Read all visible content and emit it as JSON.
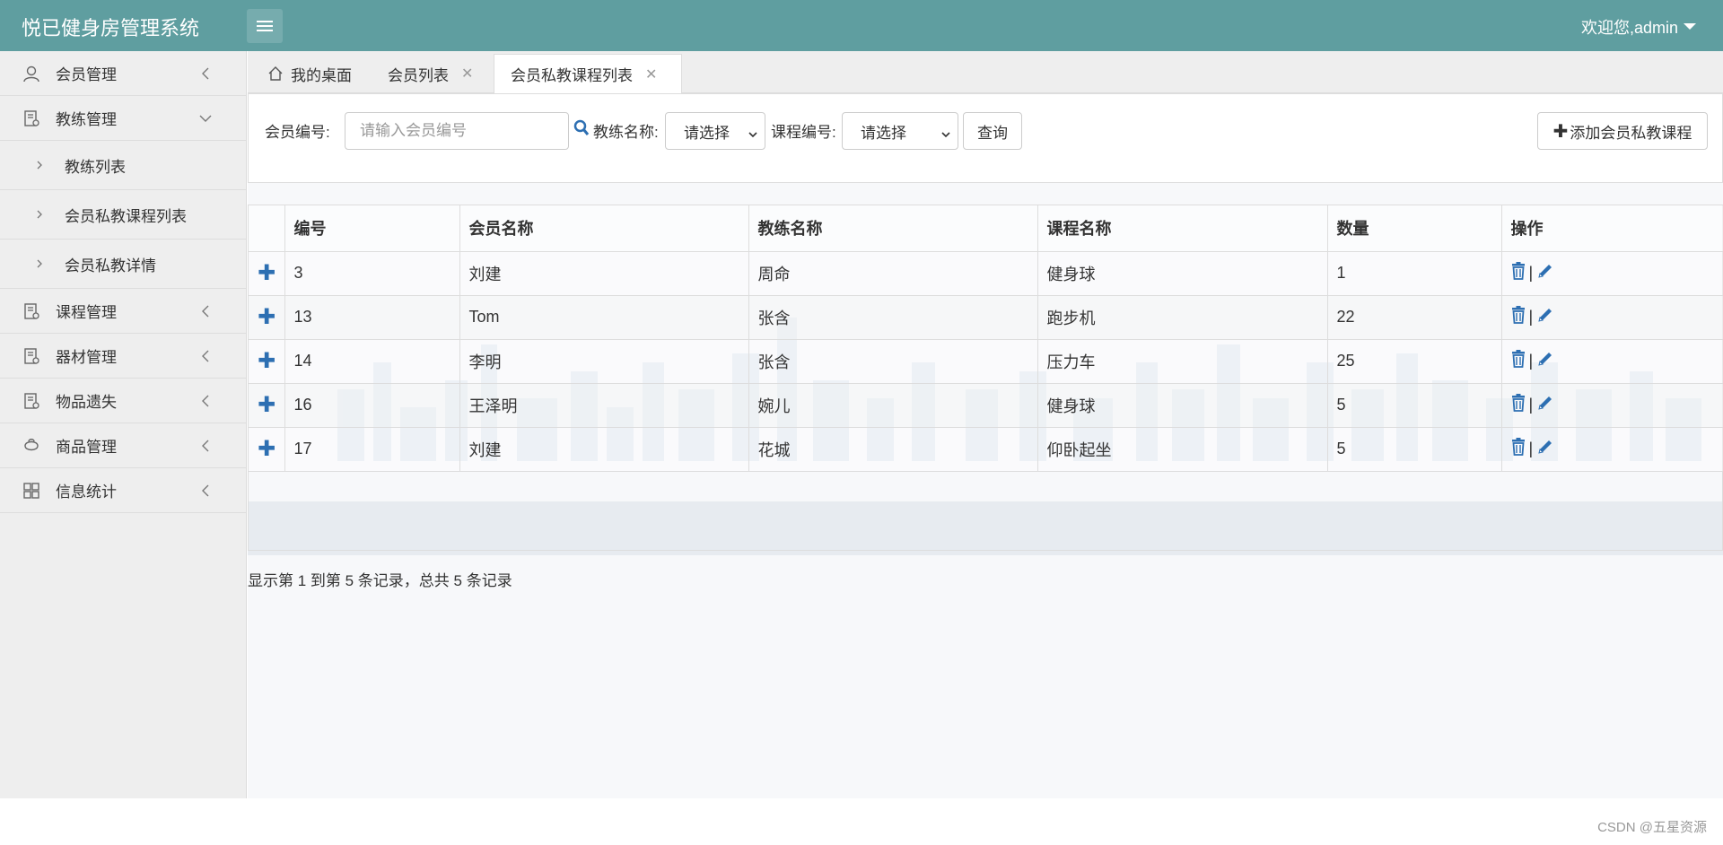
{
  "header": {
    "brand": "悦已健身房管理系统",
    "welcome": "欢迎您,admin",
    "bg_color": "#5f9ea0"
  },
  "sidebar": {
    "items": [
      {
        "label": "会员管理",
        "icon": "user-icon",
        "chevron": "left"
      },
      {
        "label": "教练管理",
        "icon": "document-icon",
        "chevron": "down"
      },
      {
        "label": "教练列表",
        "sub": true
      },
      {
        "label": "会员私教课程列表",
        "sub": true
      },
      {
        "label": "会员私教详情",
        "sub": true
      },
      {
        "label": "课程管理",
        "icon": "document-icon",
        "chevron": "left"
      },
      {
        "label": "器材管理",
        "icon": "document-icon",
        "chevron": "left"
      },
      {
        "label": "物品遗失",
        "icon": "document-icon",
        "chevron": "left"
      },
      {
        "label": "商品管理",
        "icon": "shopping-icon",
        "chevron": "left"
      },
      {
        "label": "信息统计",
        "icon": "grid-icon",
        "chevron": "left"
      }
    ]
  },
  "tabs": [
    {
      "label": "我的桌面",
      "icon": "home-icon",
      "closable": false,
      "active": false
    },
    {
      "label": "会员列表",
      "closable": true,
      "active": false
    },
    {
      "label": "会员私教课程列表",
      "closable": true,
      "active": true
    }
  ],
  "search": {
    "member_no_label": "会员编号:",
    "member_no_placeholder": "请输入会员编号",
    "coach_label": "教练名称:",
    "coach_selected": "请选择",
    "course_label": "课程编号:",
    "course_selected": "请选择",
    "query_button": "查询",
    "add_button": "添加会员私教课程"
  },
  "table": {
    "columns": [
      "编号",
      "会员名称",
      "教练名称",
      "课程名称",
      "数量",
      "操作"
    ],
    "rows": [
      {
        "id": "3",
        "member": "刘建",
        "coach": "周命",
        "course": "健身球",
        "qty": "1"
      },
      {
        "id": "13",
        "member": "Tom",
        "coach": "张含",
        "course": "跑步机",
        "qty": "22"
      },
      {
        "id": "14",
        "member": "李明",
        "coach": "张含",
        "course": "压力车",
        "qty": "25"
      },
      {
        "id": "16",
        "member": "王泽明",
        "coach": "婉儿",
        "course": "健身球",
        "qty": "5"
      },
      {
        "id": "17",
        "member": "刘建",
        "coach": "花城",
        "course": "仰卧起坐",
        "qty": "5"
      }
    ]
  },
  "summary": "显示第 1 到第 5 条记录，总共 5 条记录",
  "credit": "CSDN @五星资源",
  "colors": {
    "accent_blue": "#2d6fb2"
  }
}
